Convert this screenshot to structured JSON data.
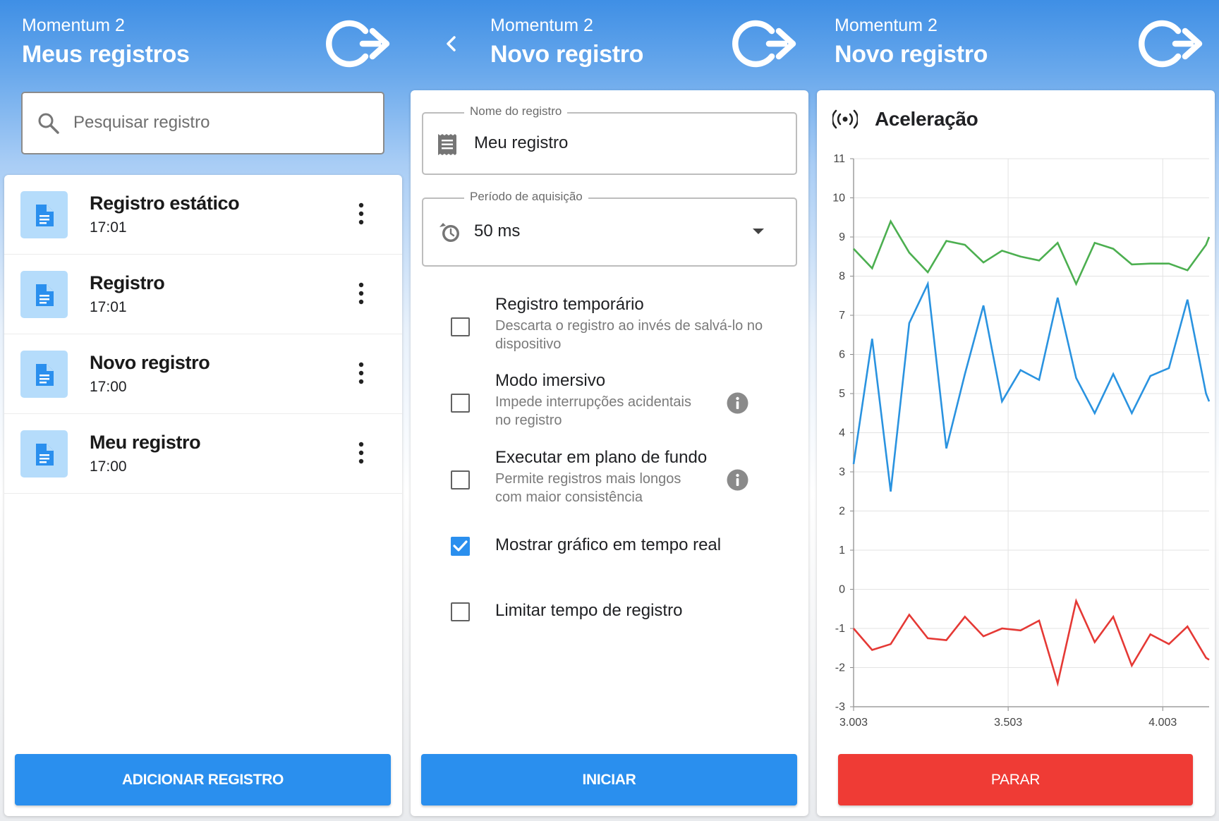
{
  "app_name": "Momentum 2",
  "colors": {
    "primary": "#2a8fee",
    "stop": "#ef3b35",
    "file_icon_bg": "#b5dcfb"
  },
  "list_screen": {
    "title": "Meus registros",
    "search_placeholder": "Pesquisar registro",
    "items": [
      {
        "title": "Registro estático",
        "time": "17:01",
        "icon": "file-document-icon"
      },
      {
        "title": "Registro",
        "time": "17:01",
        "icon": "file-document-icon"
      },
      {
        "title": "Novo registro",
        "time": "17:00",
        "icon": "file-document-icon"
      },
      {
        "title": "Meu registro",
        "time": "17:00",
        "icon": "file-document-icon"
      }
    ],
    "add_button": "ADICIONAR REGISTRO"
  },
  "new_screen": {
    "title": "Novo registro",
    "name_field": {
      "label": "Nome do registro",
      "value": "Meu registro",
      "icon": "receipt-icon"
    },
    "period_field": {
      "label": "Período de aquisição",
      "value": "50 ms",
      "icon": "timer-icon"
    },
    "options": [
      {
        "title": "Registro temporário",
        "desc1": "Descarta o registro ao invés de salvá-lo no",
        "desc2": "dispositivo",
        "checked": false,
        "info": false
      },
      {
        "title": "Modo imersivo",
        "desc1": "Impede interrupções acidentais",
        "desc2": "no registro",
        "checked": false,
        "info": true
      },
      {
        "title": "Executar em plano de fundo",
        "desc1": "Permite registros mais longos",
        "desc2": "com maior consistência",
        "checked": false,
        "info": true
      },
      {
        "title": "Mostrar gráfico em tempo real",
        "checked": true,
        "info": false
      },
      {
        "title": "Limitar tempo de registro",
        "checked": false,
        "info": false
      }
    ],
    "start_button": "INICIAR"
  },
  "record_screen": {
    "title": "Novo registro",
    "sensor_title": "Aceleração",
    "sensor_icon": "broadcast-icon",
    "stop_button": "PARAR"
  },
  "chart_data": {
    "type": "line",
    "title": "Aceleração",
    "xlim": [
      3.003,
      4.153
    ],
    "ylim": [
      -3,
      11
    ],
    "x_ticks": [
      3.003,
      3.503,
      4.003
    ],
    "x_tick_labels": [
      "3.003",
      "3.503",
      "4.003"
    ],
    "y_ticks": [
      -3,
      -2,
      -1,
      0,
      1,
      2,
      3,
      4,
      5,
      6,
      7,
      8,
      9,
      10,
      11
    ],
    "grid": true,
    "x": [
      3.003,
      3.063,
      3.123,
      3.183,
      3.243,
      3.303,
      3.363,
      3.423,
      3.483,
      3.543,
      3.603,
      3.663,
      3.723,
      3.783,
      3.843,
      3.903,
      3.963,
      4.023,
      4.083,
      4.143,
      4.153
    ],
    "series": [
      {
        "color": "#4caf50",
        "values": [
          8.7,
          8.2,
          9.4,
          8.6,
          8.1,
          8.9,
          8.8,
          8.35,
          8.65,
          8.5,
          8.4,
          8.85,
          7.8,
          8.85,
          8.7,
          8.3,
          8.32,
          8.32,
          8.15,
          8.8,
          9.0
        ]
      },
      {
        "color": "#2a93e0",
        "values": [
          3.2,
          6.4,
          2.5,
          6.8,
          7.8,
          3.6,
          5.5,
          7.25,
          4.8,
          5.6,
          5.35,
          7.45,
          5.4,
          4.5,
          5.5,
          4.5,
          5.45,
          5.65,
          7.4,
          5.0,
          4.8
        ]
      },
      {
        "color": "#e53935",
        "values": [
          -1.0,
          -1.55,
          -1.4,
          -0.65,
          -1.25,
          -1.3,
          -0.7,
          -1.2,
          -1.0,
          -1.05,
          -0.8,
          -2.4,
          -0.3,
          -1.35,
          -0.7,
          -1.95,
          -1.15,
          -1.4,
          -0.95,
          -1.75,
          -1.8
        ]
      }
    ]
  }
}
